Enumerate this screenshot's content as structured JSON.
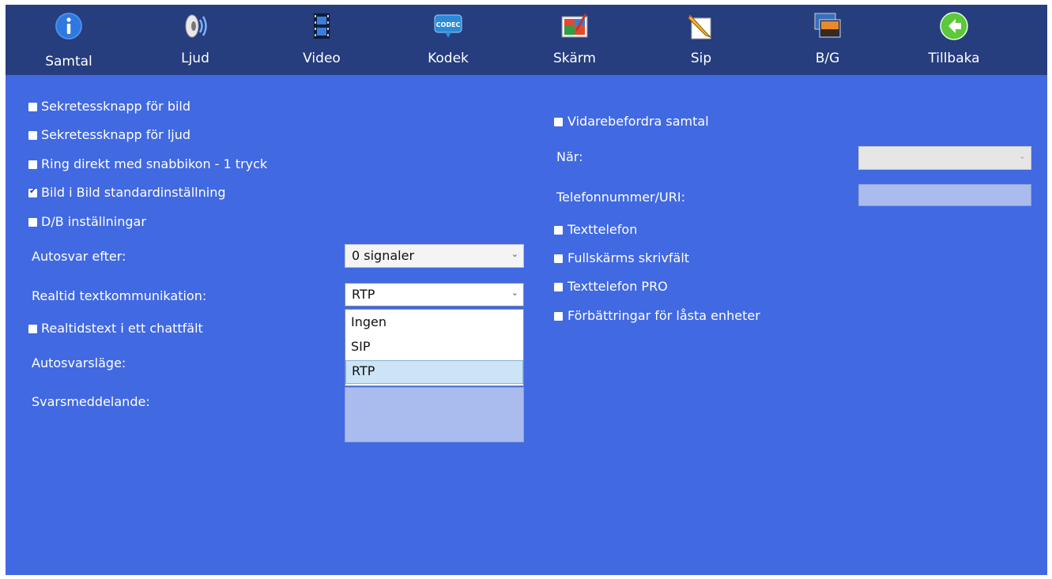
{
  "nav": {
    "tabs": [
      {
        "label": "Samtal",
        "icon": "info-icon"
      },
      {
        "label": "Ljud",
        "icon": "speaker-icon"
      },
      {
        "label": "Video",
        "icon": "film-icon"
      },
      {
        "label": "Kodek",
        "icon": "codec-icon"
      },
      {
        "label": "Skärm",
        "icon": "display-icon"
      },
      {
        "label": "Sip",
        "icon": "pencil-icon"
      },
      {
        "label": "B/G",
        "icon": "image-icon"
      },
      {
        "label": "Tillbaka",
        "icon": "back-arrow-icon"
      }
    ],
    "active": "Samtal",
    "codec_icon_text": "CODEC"
  },
  "left": {
    "checkboxes": [
      {
        "label": "Sekretessknapp för bild",
        "checked": false
      },
      {
        "label": "Sekretessknapp för ljud",
        "checked": false
      },
      {
        "label": "Ring direkt med snabbikon - 1 tryck",
        "checked": false
      },
      {
        "label": "Bild i Bild standardinställning",
        "checked": true
      },
      {
        "label": "D/B inställningar",
        "checked": false
      }
    ],
    "autosvar_label": "Autosvar efter:",
    "autosvar_value": "0 signaler",
    "rtt_label": "Realtid textkommunikation:",
    "rtt_value": "RTP",
    "rtt_options": [
      "Ingen",
      "SIP",
      "RTP"
    ],
    "rtt_highlighted": "RTP",
    "chat_checkbox": {
      "label": "Realtidstext i ett chattfält",
      "checked": false
    },
    "autosvarslage_label": "Autosvarsläge:",
    "svarsmeddelande_label": "Svarsmeddelande:"
  },
  "right": {
    "forward": {
      "label": "Vidarebefordra samtal",
      "checked": false
    },
    "nar_label": "När:",
    "nar_value": "",
    "phone_label": "Telefonnummer/URI:",
    "phone_value": "",
    "checkboxes": [
      {
        "label": "Texttelefon",
        "checked": false
      },
      {
        "label": "Fullskärms skrivfält",
        "checked": false
      },
      {
        "label": "Texttelefon PRO",
        "checked": false
      },
      {
        "label": "Förbättringar för låsta enheter",
        "checked": false
      }
    ]
  },
  "glyphs": {
    "checkmark": "✔",
    "chevron": "⌄"
  },
  "colors": {
    "background": "#4169e1",
    "nav": "#263d7e",
    "field": "#aabbee",
    "highlight": "#cce4f6"
  }
}
